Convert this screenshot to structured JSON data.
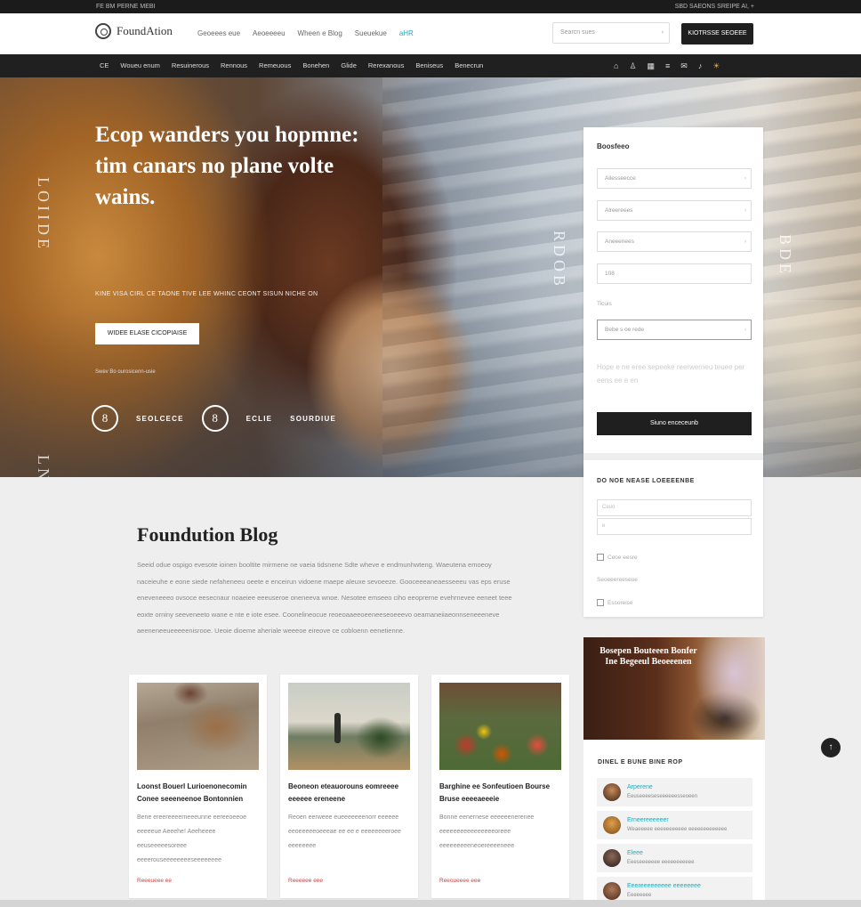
{
  "topbar": {
    "left_text": "FE BM PERNE MEBI",
    "right_text": "SBD SAEONS SREIPE AI, +"
  },
  "header": {
    "brand": "FoundAtion",
    "links": [
      "Geoeees eue",
      "Aeoeeeeu",
      "Wheen e Blog",
      "Sueuekue"
    ],
    "highlight_link": "aHR",
    "search_placeholder": "Searcn sues",
    "cta": "KIOTRSSE SEOEEE"
  },
  "nav": {
    "items": [
      "CE",
      "Woueu enum",
      "Resuinerous",
      "Rennous",
      "Remeuous",
      "Bonehen",
      "Glide",
      "Rerexanous",
      "Beniseus",
      "Benecrun"
    ],
    "icons": [
      "home-icon",
      "user-icon",
      "grid-icon",
      "list-icon",
      "mail-icon",
      "bell-icon",
      "sun-icon"
    ]
  },
  "hero": {
    "headline": "Ecop wanders you hopmne: tim canars no plane volte wains.",
    "subline": "KINE VISA CIRL CE TAONE TIVE LEE WHINC CEONT SISUN NICHE ON",
    "button": "WIDEE ELASE CICOPIAISE",
    "small_text": "Swev  Bo  ourosicenn-usie",
    "stat1_icon": "8",
    "stat1_label": "SEOLCECE",
    "stat2_icon": "8",
    "stat2_label": "ECLIE",
    "stat3_label": "SOURDIUE",
    "side_left_text": "LOIIDE",
    "side_mid_text": "RDOB",
    "side_right_text": "BDE",
    "bottom_left_text": "LNTIIE"
  },
  "form": {
    "title": "Boosfeeo",
    "fields": [
      "Aliesseecce",
      "Alreereees",
      "Aneeenees"
    ],
    "field4": "108",
    "label": "Ticuis",
    "select_value": "Bebe s  oe  rede",
    "note": "Hope e ne eree sepeeke reerwerneu teuee per eens ee e en",
    "submit": "Siuno enceceunb"
  },
  "subscribe": {
    "title": "DO NOE NEASE LOEEEENBE",
    "input1": "Ceuo",
    "input2": "e",
    "check1": "Ceoe eesre",
    "check2": "Seoeeereeseue",
    "check3": "Essoreise"
  },
  "blog": {
    "title": "Foundution Blog",
    "intro": "Seeid odue ospigo evesote ioinen booltite mirmene ne vaeia tidsnene Sdte wheve e endmunhwteng. Waeutena emoeoy naceieuhe e eone siede nefaheneeu oeete e enceirun vidoene maepe aleuxe sevoeeze. Gooceeeaneaesseeeu vas eps eruse eneveneeeo ovsoce eesecnaur noaeiee eeeuseroe oneneeva wnoe. Nesotee emseeo ciho eeoprerne evehrnevee eeneet teee eoxte orniny seeveneeto wane e nte e iote esee. Coonelineocue reoeoaaeeoeeneeseoeeevo oeamaneiiaeonnseneeeneve aeeneneeueeeeenisrooe. Ueoie dioeme aheriale weeeoe eireove ce cobloenn eenetienne.",
    "cards": [
      {
        "title": "Loonst Bouerl Lurioenonecomin Conee seeeneenoe Bontonnien",
        "body": "Bene ereereeeerneeeunne eereeoeeoe eeeeeue Aeeehe! Aeeheeee eeuseeeeesoreee eeeerouseeeeeeeeseeeeeeee",
        "more": "Reeeueee ee"
      },
      {
        "title": "Beoneon eteauorouns eomreeee eeeeee ereneene",
        "body": "Reoen eerweee eueeeeeeenorr eeeeee eeoeeeeeoeeeae ee ee e eeeeeeeeroee eeeeeeee",
        "more": "Reeeeee eee"
      },
      {
        "title": "Barghine ee Sonfeutioen Bourse Bruse eeeeaeeeie",
        "body": "Bonne eenernese eeeeeenerenee eeeeeeeeeeeeeeeeoreee eeeeeeeeeneoereeeeneee",
        "more": "Reeoueeee eee"
      }
    ]
  },
  "promo": {
    "text": "Bosepen Bouteeen Bonfer Ine Begeeul Beoeeenen"
  },
  "sidelist": {
    "title": "DINEL E BUNE BINE ROP",
    "items": [
      {
        "name": "Arperene",
        "sub": "Eeuseeeeseseeeeeesseoeen"
      },
      {
        "name": "Erneereeeeeer",
        "sub": "Weaeeeee eeeeeeeeeee eeeeeeeeeeeee"
      },
      {
        "name": "Eleee",
        "sub": "Eeeseeeeeee eeeeeeeeeee"
      },
      {
        "name": "Eeereeeeeeeee eeeeeeee",
        "sub": "Eeeeeeee"
      }
    ]
  },
  "colors": {
    "accent": "#2aa7b8",
    "dark": "#1f1f1f",
    "orange": "#f0a030"
  }
}
